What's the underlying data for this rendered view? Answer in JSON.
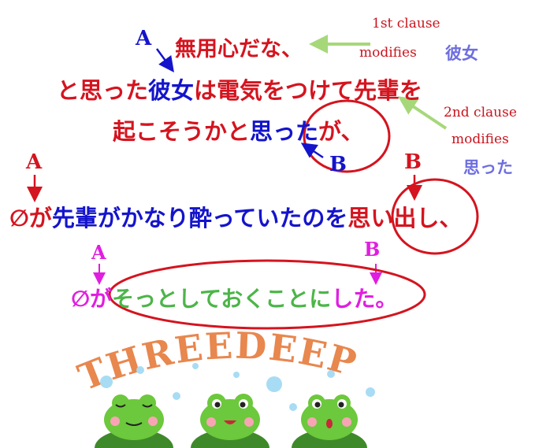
{
  "colors": {
    "red": "#d4141f",
    "blue": "#1414cc",
    "purple_blue": "#6e6ee0",
    "magenta": "#e01ee0",
    "green_text": "#4cb548",
    "green_arrow": "#a6d87a",
    "orange": "#e8874e",
    "frog_green": "#6cc83c"
  },
  "sentence": {
    "line1": [
      {
        "text": "無用心だな、",
        "color": "red"
      }
    ],
    "line2": [
      {
        "text": "と思った",
        "color": "red"
      },
      {
        "text": "彼女",
        "color": "blue"
      },
      {
        "text": "は電気をつけて先輩を",
        "color": "red"
      }
    ],
    "line3": [
      {
        "text": "起こそうかと",
        "color": "red"
      },
      {
        "text": "思った",
        "color": "blue"
      },
      {
        "text": "が、",
        "color": "red"
      }
    ],
    "line4": [
      {
        "text": "∅が",
        "color": "red"
      },
      {
        "text": "先輩がかなり酔っていたのを",
        "color": "blue"
      },
      {
        "text": "思い出し、",
        "color": "red"
      }
    ],
    "line5": [
      {
        "text": "∅が",
        "color": "magenta"
      },
      {
        "text": "そっとしておくことに",
        "color": "green_text"
      },
      {
        "text": "した。",
        "color": "magenta"
      }
    ]
  },
  "markers": {
    "a1": "A",
    "b1": "B",
    "a2": "A",
    "b2": "B",
    "a3": "A",
    "b3": "B"
  },
  "notes": {
    "first_clause": {
      "line1": "1st clause",
      "line2": "modifies",
      "target": "彼女"
    },
    "second_clause": {
      "line1": "2nd clause",
      "line2": "modifies",
      "target": "思った"
    }
  },
  "logo": {
    "text": "THREEDEEP"
  }
}
